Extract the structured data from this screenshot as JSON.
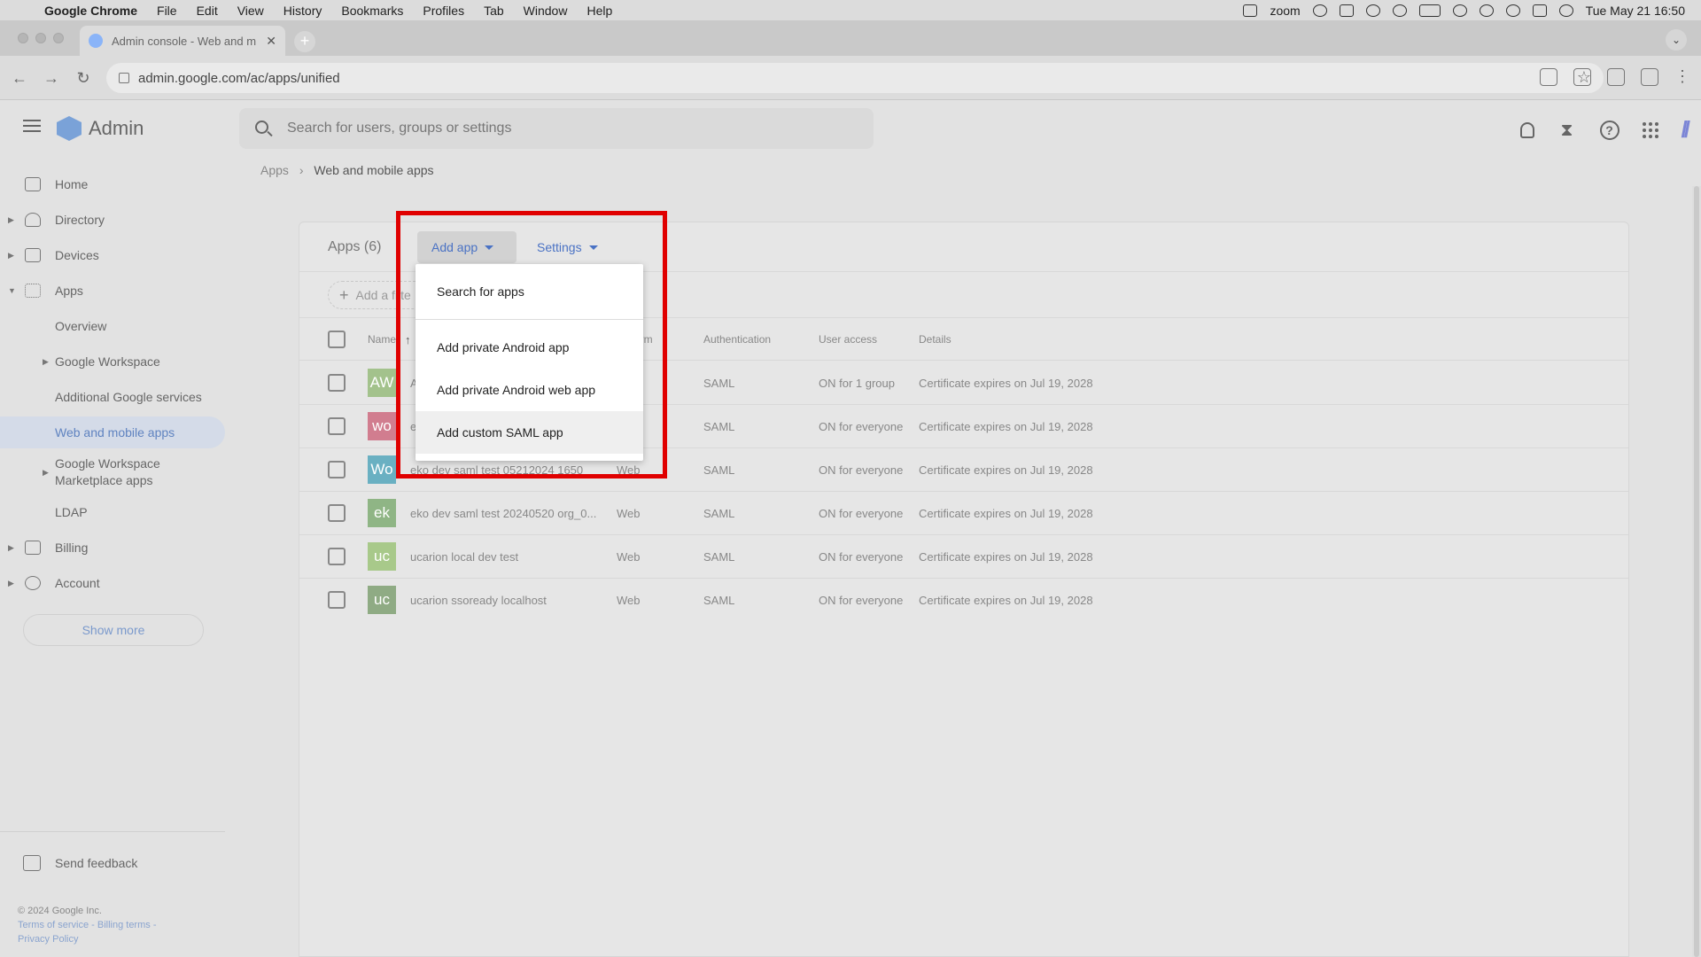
{
  "os_menubar": {
    "app_name": "Google Chrome",
    "items": [
      "File",
      "Edit",
      "View",
      "History",
      "Bookmarks",
      "Profiles",
      "Tab",
      "Window",
      "Help"
    ],
    "zoom_label": "zoom",
    "datetime": "Tue May 21  16:50"
  },
  "browser": {
    "tab_title": "Admin console - Web and m",
    "url": "admin.google.com/ac/apps/unified"
  },
  "header": {
    "logo_text": "Admin",
    "search_placeholder": "Search for users, groups or settings"
  },
  "breadcrumb": {
    "parent": "Apps",
    "separator": "›",
    "current": "Web and mobile apps"
  },
  "sidebar": {
    "items": [
      {
        "label": "Home",
        "icon": "home-icon"
      },
      {
        "label": "Directory",
        "icon": "person-icon"
      },
      {
        "label": "Devices",
        "icon": "devices-icon"
      },
      {
        "label": "Apps",
        "icon": "apps-grid-icon"
      },
      {
        "label": "Overview"
      },
      {
        "label": "Google Workspace"
      },
      {
        "label": "Additional Google services"
      },
      {
        "label": "Web and mobile apps"
      },
      {
        "label": "Google Workspace"
      },
      {
        "label": "Marketplace apps"
      },
      {
        "label": "LDAP"
      },
      {
        "label": "Billing",
        "icon": "billing-icon"
      },
      {
        "label": "Account",
        "icon": "at-icon"
      }
    ],
    "show_more": "Show more",
    "send_feedback": "Send feedback",
    "footer": {
      "copyright": "© 2024 Google Inc.",
      "terms": "Terms of service",
      "billing_terms": "Billing terms",
      "privacy": "Privacy Policy",
      "dash": " - "
    }
  },
  "main": {
    "apps_count": "Apps (6)",
    "add_app_label": "Add app",
    "settings_label": "Settings",
    "add_filter_label": "Add a filte",
    "columns": {
      "name": "Name",
      "platform": "orm",
      "authentication": "Authentication",
      "user_access": "User access",
      "details": "Details"
    },
    "rows": [
      {
        "initials": "AW",
        "avatar_color": "#a3c28c",
        "name": "A",
        "platform": "",
        "auth": "SAML",
        "access": "ON for 1 group",
        "details": "Certificate expires on Jul 19, 2028"
      },
      {
        "initials": "wo",
        "avatar_color": "#d17d8f",
        "name": "e",
        "platform": "",
        "auth": "SAML",
        "access": "ON for everyone",
        "details": "Certificate expires on Jul 19, 2028"
      },
      {
        "initials": "Wo",
        "avatar_color": "#6ab0c2",
        "name": "eko dev saml test 05212024 1650",
        "platform": "Web",
        "auth": "SAML",
        "access": "ON for everyone",
        "details": "Certificate expires on Jul 19, 2028"
      },
      {
        "initials": "ek",
        "avatar_color": "#8fb585",
        "name": "eko dev saml test 20240520 org_0...",
        "platform": "Web",
        "auth": "SAML",
        "access": "ON for everyone",
        "details": "Certificate expires on Jul 19, 2028"
      },
      {
        "initials": "uc",
        "avatar_color": "#a8c98a",
        "name": "ucarion local dev test",
        "platform": "Web",
        "auth": "SAML",
        "access": "ON for everyone",
        "details": "Certificate expires on Jul 19, 2028"
      },
      {
        "initials": "uc",
        "avatar_color": "#8fab84",
        "name": "ucarion ssoready localhost",
        "platform": "Web",
        "auth": "SAML",
        "access": "ON for everyone",
        "details": "Certificate expires on Jul 19, 2028"
      }
    ]
  },
  "add_app_menu": {
    "items": [
      "Search for apps",
      "Add private Android app",
      "Add private Android web app",
      "Add custom SAML app"
    ]
  },
  "colors": {
    "accent_blue": "#4a72c4",
    "highlight_red": "#e00000"
  }
}
